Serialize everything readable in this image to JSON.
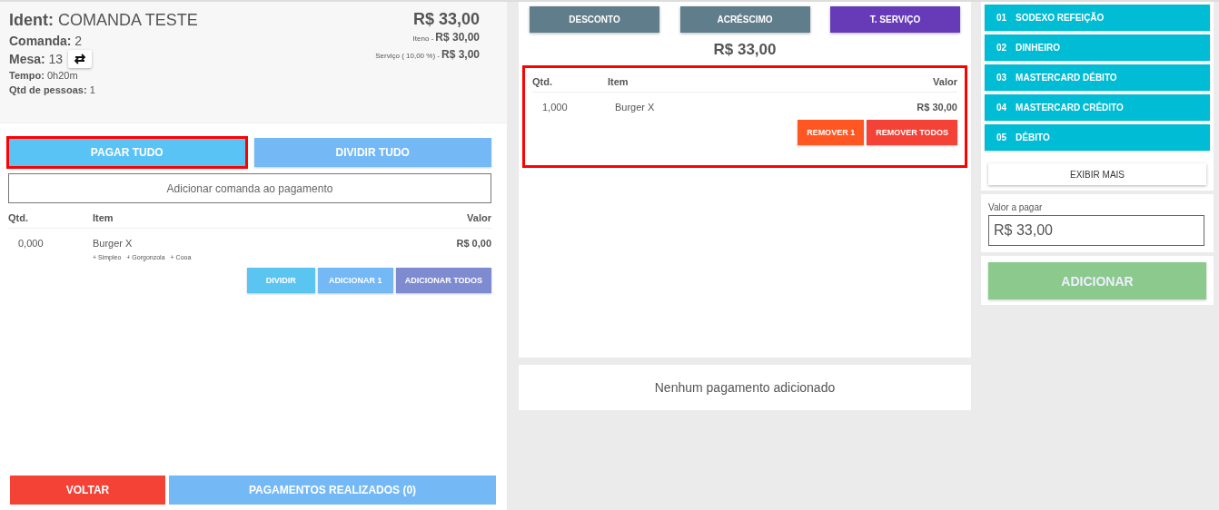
{
  "header": {
    "ident_label": "Ident:",
    "ident_value": "COMANDA TESTE",
    "comanda_label": "Comanda:",
    "comanda_value": "2",
    "mesa_label": "Mesa:",
    "mesa_value": "13",
    "tempo_label": "Tempo:",
    "tempo_value": "0h20m",
    "pessoas_label": "Qtd de pessoas:",
    "pessoas_value": "1",
    "total": "R$ 33,00",
    "itens_label": "Iteno -",
    "itens_value": "R$ 30,00",
    "servico_label": "Serviço ( 10,00 %) -",
    "servico_value": "R$ 3,00"
  },
  "left_actions": [
    {
      "label": "PAGAR TUDO",
      "color": "#5ac3f6",
      "highlighted": true
    },
    {
      "label": "DIVIDIR TUDO",
      "color": "#74b9f5",
      "highlighted": false
    }
  ],
  "add_comanda": "Adicionar comanda ao pagamento",
  "left_table": {
    "columns": [
      "Qtd.",
      "Item",
      "Valor"
    ],
    "rows": [
      {
        "qty": "0,000",
        "item": "Burger X",
        "value": "R$ 0,00",
        "addons": [
          "+ Simpleo",
          "+ Gorgonzola",
          "+ Cooa"
        ],
        "buttons": [
          {
            "label": "DIVIDIR",
            "color": "#5bc5f2"
          },
          {
            "label": "ADICIONAR 1",
            "color": "#74b9f5"
          },
          {
            "label": "ADICIONAR TODOS",
            "color": "#7f8bd0"
          }
        ]
      }
    ]
  },
  "bottom_buttons": [
    {
      "label": "VOLTAR",
      "color": "#f44336"
    },
    {
      "label": "PAGAMENTOS REALIZADOS (0)",
      "color": "#74b9f5"
    }
  ],
  "adjust_buttons": [
    {
      "label": "DESCONTO",
      "color": "#607d8b"
    },
    {
      "label": "ACRÉSCIMO",
      "color": "#607d8b"
    },
    {
      "label": "T. SERVIÇO",
      "color": "#673ab7"
    }
  ],
  "payment_total": "R$ 33,00",
  "payment_table": {
    "highlighted": true,
    "columns": [
      "Qtd.",
      "Item",
      "Valor"
    ],
    "rows": [
      {
        "qty": "1,000",
        "item": "Burger X",
        "value": "R$ 30,00",
        "buttons": [
          {
            "label": "REMOVER 1",
            "color": "#ff5722"
          },
          {
            "label": "REMOVER TODOS",
            "color": "#f44336"
          }
        ]
      }
    ]
  },
  "no_payments": "Nenhum pagamento adicionado",
  "methods": [
    {
      "code": "01",
      "name": "SODEXO REFEIÇÃO"
    },
    {
      "code": "02",
      "name": "DINHEIRO"
    },
    {
      "code": "03",
      "name": "MASTERCARD DÉBITO"
    },
    {
      "code": "04",
      "name": "MASTERCARD CRÉDITO"
    },
    {
      "code": "05",
      "name": "DÉBITO"
    }
  ],
  "show_more": "EXIBIR MAIS",
  "amount": {
    "label": "Valor a pagar",
    "value": "R$ 33,00"
  },
  "add_button": "ADICIONAR"
}
